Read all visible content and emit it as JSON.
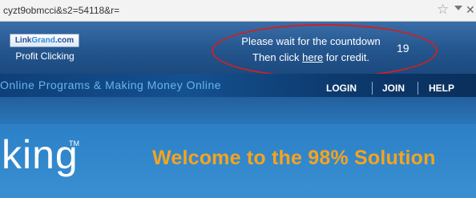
{
  "browser": {
    "url": "cyzt9obmcci&s2=54118&r="
  },
  "timer_bar": {
    "logo": {
      "part1": "Link",
      "part2": "Grand",
      "part3": ".com"
    },
    "tagline": "Profit Clicking",
    "wait_text": "Please wait for the countdown",
    "then_click": "Then click ",
    "here_link": "here",
    "for_credit": " for credit.",
    "countdown": "19"
  },
  "site_nav": {
    "banner_text": "Online Programs & Making Money Online",
    "links": [
      "LOGIN",
      "JOIN",
      "HELP"
    ]
  },
  "hero": {
    "word": "king",
    "trademark": "TM",
    "welcome": "Welcome to the 98% Solution"
  },
  "colors": {
    "accent_orange": "#f7a31e",
    "highlight_red": "#cc2222",
    "nav_blue": "#14508f"
  }
}
